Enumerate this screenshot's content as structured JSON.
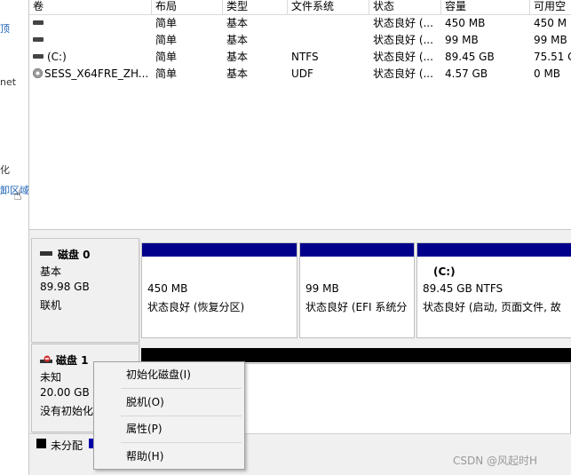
{
  "left_pane": {
    "fragments": [
      "顶",
      "net",
      "化",
      "卸区域"
    ]
  },
  "volume_table": {
    "columns": [
      "卷",
      "布局",
      "类型",
      "文件系统",
      "状态",
      "容量",
      "可用空"
    ],
    "rows": [
      {
        "name": "",
        "icon": "drive-icon",
        "layout": "简单",
        "type": "基本",
        "fs": "",
        "status": "状态良好 (...",
        "capacity": "450 MB",
        "free": "450 M"
      },
      {
        "name": "",
        "icon": "drive-icon",
        "layout": "简单",
        "type": "基本",
        "fs": "",
        "status": "状态良好 (...",
        "capacity": "99 MB",
        "free": "99 MB"
      },
      {
        "name": "(C:)",
        "icon": "drive-icon",
        "layout": "简单",
        "type": "基本",
        "fs": "NTFS",
        "status": "状态良好 (...",
        "capacity": "89.45 GB",
        "free": "75.51 G"
      },
      {
        "name": "SESS_X64FRE_ZH...",
        "icon": "disc-icon",
        "layout": "简单",
        "type": "基本",
        "fs": "UDF",
        "status": "状态良好 (...",
        "capacity": "4.57 GB",
        "free": "0 MB"
      }
    ]
  },
  "disk0": {
    "title": "磁盘 0",
    "type": "基本",
    "size": "89.98 GB",
    "state": "联机",
    "partitions": [
      {
        "size": "450 MB",
        "status": "状态良好 (恢复分区)"
      },
      {
        "size": "99 MB",
        "status": "状态良好 (EFI 系统分"
      },
      {
        "name": "(C:)",
        "size": "89.45 GB NTFS",
        "status": "状态良好 (启动, 页面文件, 故"
      }
    ]
  },
  "disk1": {
    "title": "磁盘 1",
    "type": "未知",
    "size": "20.00 GB",
    "state": "没有初始化"
  },
  "legend": {
    "unallocated": "未分配"
  },
  "context_menu": {
    "items": [
      "初始化磁盘(I)",
      "脱机(O)",
      "属性(P)",
      "帮助(H)"
    ]
  },
  "colors": {
    "partition_stripe": "#00008b",
    "unallocated": "#000000",
    "menu_bg": "#f2f2f2"
  },
  "watermark": "CSDN @风起时H"
}
